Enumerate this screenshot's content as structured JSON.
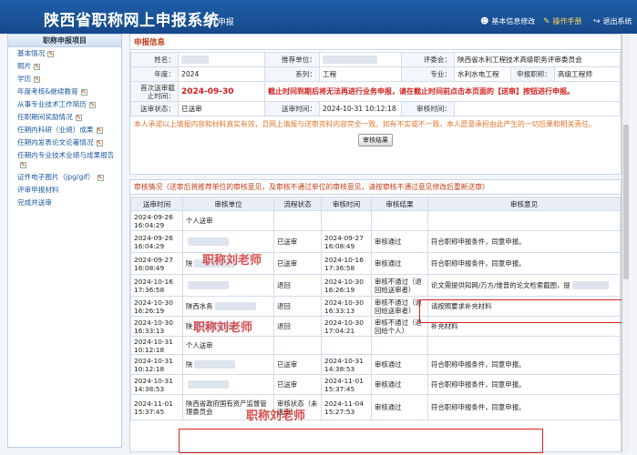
{
  "header": {
    "title": "陕西省职称网上申报系统",
    "subtitle": "申报",
    "links": [
      {
        "label": "基本信息修改",
        "icon": "user-icon"
      },
      {
        "label": "操作手册",
        "icon": "manual-icon"
      },
      {
        "label": "退出系统",
        "icon": "logout-icon"
      }
    ]
  },
  "sidebar": {
    "heading": "职称申报项目",
    "items": [
      {
        "label": "基本情况",
        "edit": true
      },
      {
        "label": "照片",
        "edit": true
      },
      {
        "label": "学历",
        "edit": true
      },
      {
        "label": "年度考核&继续教育",
        "edit": true
      },
      {
        "label": "从事专业技术工作简历",
        "edit": true
      },
      {
        "label": "任职期间奖励情况",
        "edit": true
      },
      {
        "label": "任期内科研（业绩）成果",
        "edit": true
      },
      {
        "label": "任期内发表论文论著情况",
        "edit": true
      },
      {
        "label": "任期内专业技术业绩与成果报告",
        "edit": true
      },
      {
        "label": "证件电子图片（jpg/gif）",
        "edit": true
      },
      {
        "label": "评审申报材料",
        "edit": false
      },
      {
        "label": "完成并送审",
        "edit": false
      }
    ]
  },
  "info": {
    "title": "申报信息",
    "name_label": "姓名：",
    "unit_label": "推荐单位：",
    "committee_label": "评委会：",
    "committee": "陕西省水利工程技术高级职务评审委员会",
    "year_label": "年度：",
    "year": "2024",
    "series_label": "系列：",
    "series": "工程",
    "major_label": "专业：",
    "major": "水利水电工程",
    "rank_label": "申报职称：",
    "rank": "高级工程师",
    "deadline_label": "首次送审截止时间：",
    "deadline": "2024-09-30",
    "deadline_notice": "截止时间到期后将无法再进行业务申报，请在截止时间前点击本页面的【送审】按钮进行申报。",
    "status_label": "送审状态：",
    "status": "已送审",
    "send_time_label": "送审时间：",
    "send_time": "2024-10-31 10:12:18",
    "review_time_label": "审核时间：",
    "promise": "本人承诺以上填报内容和材料真实有效，且网上填报与送审资料内容完全一致。如有不实或不一致，本人愿意承担由此产生的一切后果和相关责任。",
    "button": "审核结果"
  },
  "review": {
    "title": "审核情况（送审后将推荐单位的审核意见，及审核不通过单位的审核意见，请按审核不通过意见修改后重新送审）",
    "columns": [
      "送审时间",
      "审核单位",
      "流程状态",
      "审核时间",
      "审核结果",
      "审核意见"
    ],
    "rows": [
      {
        "send": "2024-09-26 16:04:29",
        "unit": "个人送审",
        "state": "",
        "time": "",
        "result": "",
        "opinion": ""
      },
      {
        "send": "2024-09-26 16:04:29",
        "unit": "",
        "state": "已送审",
        "time": "2024-09-27 16:08:49",
        "result": "审核通过",
        "opinion": "符合职称申报条件，同意申报。"
      },
      {
        "send": "2024-09-27 16:08:49",
        "unit": "陕",
        "state": "已送审",
        "time": "2024-10-16 17:36:58",
        "result": "审核通过",
        "opinion": "符合职称申报条件，同意申报。"
      },
      {
        "send": "2024-10-16 17:36:58",
        "unit": "",
        "state": "退回",
        "time": "2024-10-30 16:26:19",
        "result": "审核不通过（退回给送审者）",
        "opinion": "论文需提供知网/万方/维普的论文检索截图，提"
      },
      {
        "send": "2024-10-30 16:26:19",
        "unit": "陕西水务",
        "state": "退回",
        "time": "2024-10-30 16:33:13",
        "result": "审核不通过（退回给送审者）",
        "opinion": "请按照要求补充材料"
      },
      {
        "send": "2024-10-30 16:33:13",
        "unit": "陕",
        "state": "退回",
        "time": "2024-10-30 17:04:21",
        "result": "审核不通过（退回给个人）",
        "opinion": "补充材料"
      },
      {
        "send": "2024-10-31 10:12:18",
        "unit": "个人送审",
        "state": "",
        "time": "",
        "result": "",
        "opinion": ""
      },
      {
        "send": "2024-10-31 10:12:18",
        "unit": "陕",
        "state": "已送审",
        "time": "2024-10-31 14:38:53",
        "result": "审核通过",
        "opinion": "符合职称申报条件，同意申报。"
      },
      {
        "send": "2024-10-31 14:38:53",
        "unit": "",
        "state": "已送审",
        "time": "2024-11-01 15:37:45",
        "result": "审核通过",
        "opinion": "符合职称申报条件，同意申报。"
      },
      {
        "send": "2024-11-01 15:37:45",
        "unit": "陕西省政府国有资产监督管理委员会",
        "state": "审核状态（未送审）",
        "time": "2024-11-04 15:27:53",
        "result": "审核通过",
        "opinion": "符合职称申报条件，同意申报。"
      }
    ]
  },
  "watermark": "职称刘老师"
}
